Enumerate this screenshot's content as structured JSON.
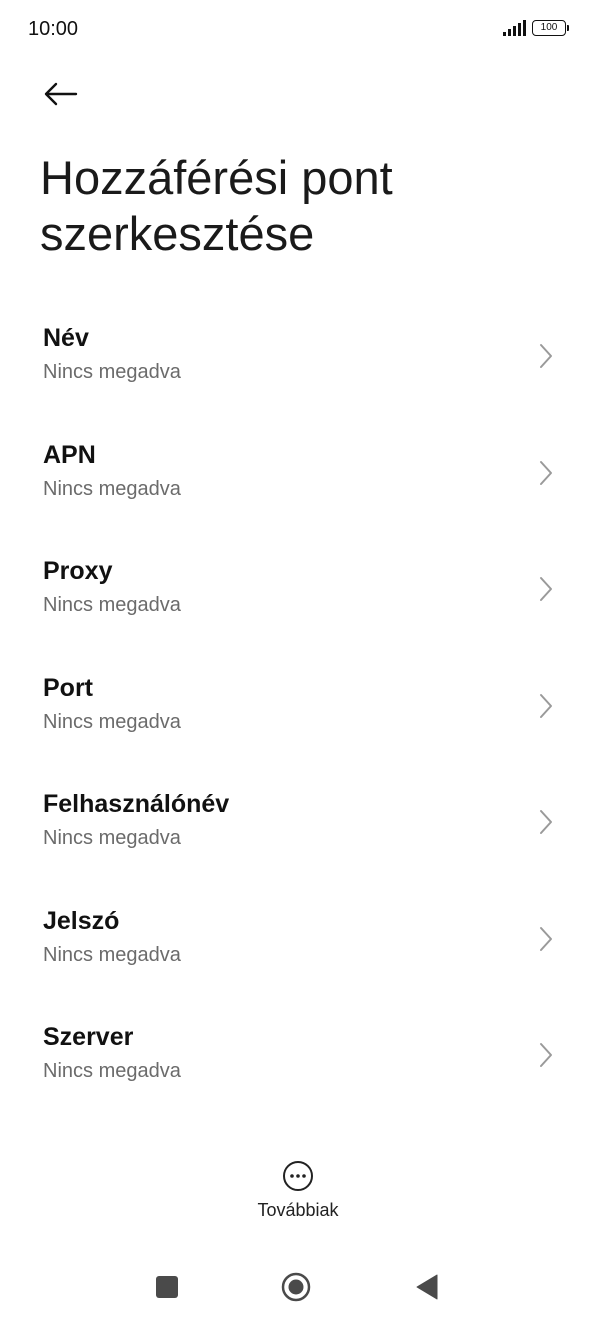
{
  "status_bar": {
    "time": "10:00",
    "battery": "100"
  },
  "header": {
    "back_icon": "arrow-left-icon",
    "title": "Hozzáférési pont szerkesztése"
  },
  "settings": [
    {
      "label": "Név",
      "value": "Nincs megadva"
    },
    {
      "label": "APN",
      "value": "Nincs megadva"
    },
    {
      "label": "Proxy",
      "value": "Nincs megadva"
    },
    {
      "label": "Port",
      "value": "Nincs megadva"
    },
    {
      "label": "Felhasználónév",
      "value": "Nincs megadva"
    },
    {
      "label": "Jelszó",
      "value": "Nincs megadva"
    },
    {
      "label": "Szerver",
      "value": "Nincs megadva"
    }
  ],
  "more": {
    "icon": "more-horizontal-circle-icon",
    "label": "Továbbiak"
  },
  "nav_bar": {
    "recents_icon": "square-icon",
    "home_icon": "circle-icon",
    "back_icon": "triangle-back-icon"
  },
  "colors": {
    "text_primary": "#111111",
    "text_secondary": "#6b6b6b",
    "chevron": "#9a9a9a",
    "nav_icons": "#4a4a4a"
  }
}
